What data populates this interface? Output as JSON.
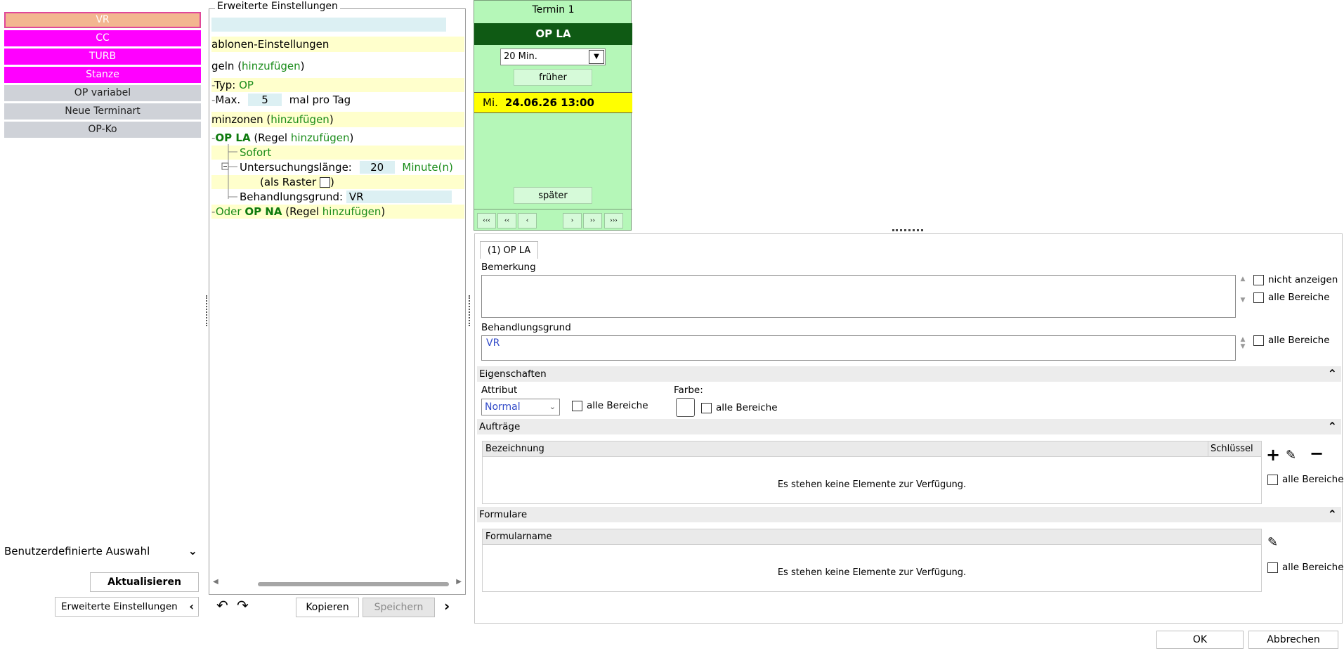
{
  "left": {
    "appointment_types": [
      {
        "label": "VR",
        "style": "selected"
      },
      {
        "label": "CC",
        "style": "magenta"
      },
      {
        "label": "TURB",
        "style": "magenta"
      },
      {
        "label": "Stanze",
        "style": "magenta"
      },
      {
        "label": "OP variabel",
        "style": "gray"
      },
      {
        "label": "Neue Terminart",
        "style": "gray"
      },
      {
        "label": "OP-Ko",
        "style": "gray"
      }
    ],
    "custom_selection": "Benutzerdefinierte Auswahl",
    "refresh_label": "Aktualisieren",
    "advanced_label": "Erweiterte Einstellungen"
  },
  "tree": {
    "group_title": "Erweiterte Einstellungen",
    "template_settings": "ablonen-Einstellungen",
    "rules_prefix": "geln (",
    "add": "hinzufügen",
    "close_paren": ")",
    "type_label": "Typ: ",
    "type_value": "OP",
    "max_label": "Max.",
    "max_value": "5",
    "max_suffix": "mal pro Tag",
    "zones_prefix": "minzonen (",
    "rule_op_la": "OP LA",
    "rule_prefix": " (Regel ",
    "immediate": "Sofort",
    "exam_length_label": "Untersuchungslänge:",
    "exam_length_value": "20",
    "minutes": "Minute(n)",
    "as_grid": "(als Raster",
    "reason_label": "Behandlungsgrund: ",
    "reason_value": "VR",
    "or_label": "Oder ",
    "rule_op_na": "OP NA",
    "copy_label": "Kopieren",
    "save_label": "Speichern"
  },
  "appointment": {
    "title": "Termin 1",
    "type": "OP LA",
    "duration": "20 Min.",
    "earlier": "früher",
    "day": "Mi.",
    "datetime": "24.06.26 13:00",
    "later": "später",
    "nav": [
      "‹‹‹",
      "‹‹",
      "‹",
      "›",
      "››",
      "›››"
    ]
  },
  "detail": {
    "tab": "(1) OP LA",
    "remark_label": "Bemerkung",
    "hide_label": "nicht anzeigen",
    "all_areas": "alle Bereiche",
    "reason_label": "Behandlungsgrund",
    "reason_value": "VR",
    "properties_section": "Eigenschaften",
    "attribute_label": "Attribut",
    "attribute_value": "Normal",
    "color_label": "Farbe:",
    "orders_section": "Aufträge",
    "col_name": "Bezeichnung",
    "col_key": "Schlüssel",
    "empty_text": "Es stehen keine Elemente zur Verfügung.",
    "forms_section": "Formulare",
    "col_formname": "Formularname"
  },
  "footer": {
    "ok": "OK",
    "cancel": "Abbrechen"
  },
  "colors": {
    "magenta": "#ff00ff",
    "selected": "#f3b690",
    "appt_green": "#b5f7b8",
    "appt_dark": "#0f5a14",
    "date_yellow": "#ffff00"
  }
}
